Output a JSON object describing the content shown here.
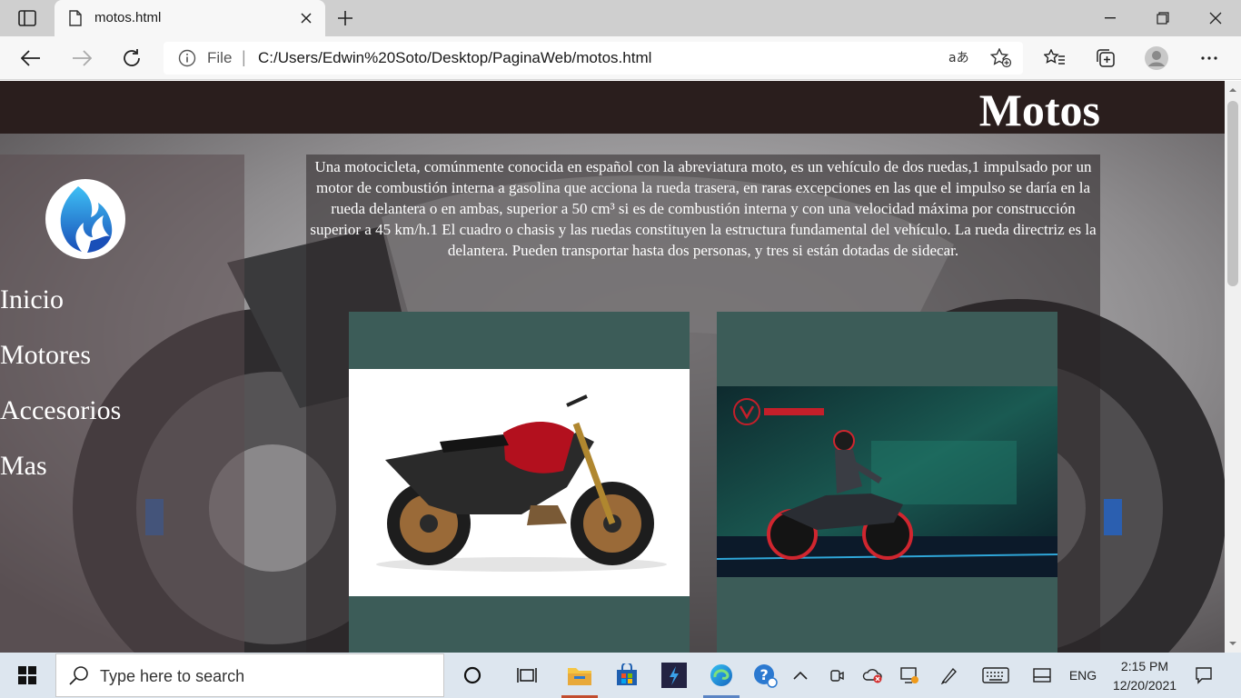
{
  "browser": {
    "tab_title": "motos.html",
    "address_prefix": "File",
    "address_separator": "|",
    "url": "C:/Users/Edwin%20Soto/Desktop/PaginaWeb/motos.html"
  },
  "page": {
    "header_title": "Motos",
    "menu": [
      "Inicio",
      "Motores",
      "Accesorios",
      "Mas"
    ],
    "description": "Una motocicleta, comúnmente conocida en español con la abreviatura moto, es un vehículo de dos ruedas,1 impulsado por un motor de combustión interna a gasolina que acciona la rueda trasera, en raras excepciones en las que el impulso se daría en la rueda delantera o en ambas, superior a 50 cm³ si es de combustión interna y con una velocidad máxima por construcción superior a 45 km/h.1 El cuadro o chasis y las ruedas constituyen la estructura fundamental del vehículo. La rueda directriz es la delantera. Pueden transportar hasta dos personas, y tres si están dotadas de sidecar.",
    "colors": {
      "header_bg": "#2a1e1d",
      "card_bg": "#3c5c58",
      "text": "#ffffff"
    }
  },
  "taskbar": {
    "search_placeholder": "Type here to search",
    "language": "ENG",
    "time": "2:15 PM",
    "date": "12/20/2021"
  }
}
